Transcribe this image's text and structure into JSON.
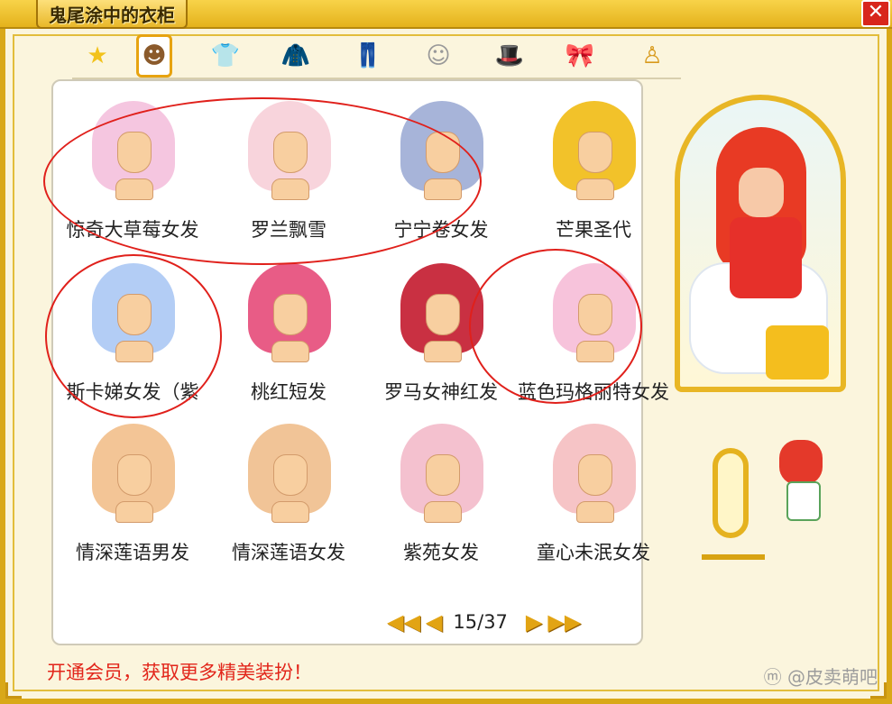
{
  "window": {
    "title": "鬼尾涂中的衣柜",
    "close_label": "✕"
  },
  "tabs": [
    {
      "icon": "star-icon",
      "glyph": "★",
      "color": "#f2c21a"
    },
    {
      "icon": "hair-icon",
      "glyph": "☻",
      "color": "#8b5a2b",
      "active": true
    },
    {
      "icon": "top-icon",
      "glyph": "👕",
      "color": "#9ac43b"
    },
    {
      "icon": "coat-icon",
      "glyph": "🧥",
      "color": "#9b5b2d"
    },
    {
      "icon": "pants-icon",
      "glyph": "👖",
      "color": "#5a7fbf"
    },
    {
      "icon": "face-icon",
      "glyph": "☺",
      "color": "#999"
    },
    {
      "icon": "hat-icon",
      "glyph": "🎩",
      "color": "#6fa8c8"
    },
    {
      "icon": "accessory-icon",
      "glyph": "🎀",
      "color": "#e56aa0"
    },
    {
      "icon": "body-icon",
      "glyph": "♙",
      "color": "#d89a1c"
    }
  ],
  "items": [
    {
      "label": "惊奇大草莓女发",
      "color": "#f5c6e0"
    },
    {
      "label": "罗兰飘雪",
      "color": "#f8d4dc"
    },
    {
      "label": "宁宁卷女发",
      "color": "#a7b4d9"
    },
    {
      "label": "芒果圣代",
      "color": "#f2c22a"
    },
    {
      "label": "斯卡娣女发（紫",
      "color": "#b3cdf5"
    },
    {
      "label": "桃红短发",
      "color": "#e85c86"
    },
    {
      "label": "罗马女神红发",
      "color": "#c93042"
    },
    {
      "label": "蓝色玛格丽特女发",
      "color": "#f7c3db"
    },
    {
      "label": "情深莲语男发",
      "color": "#f3c596"
    },
    {
      "label": "情深莲语女发",
      "color": "#f1c497"
    },
    {
      "label": "紫苑女发",
      "color": "#f4c1cf"
    },
    {
      "label": "童心未泯女发",
      "color": "#f6c4c6"
    }
  ],
  "pager": {
    "first_label": "◀◀",
    "prev_label": "◀",
    "page_text": "15/37",
    "next_label": "▶",
    "last_label": "▶▶"
  },
  "promo_text": "开通会员，获取更多精美装扮！",
  "watermark": "ⓜ @皮卖萌吧"
}
